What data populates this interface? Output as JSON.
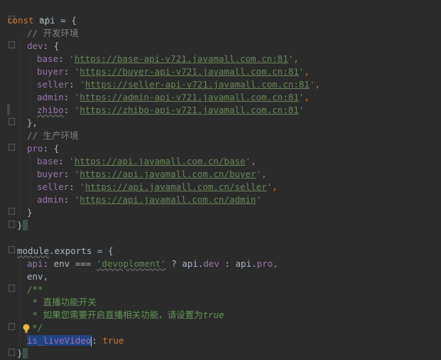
{
  "code": {
    "l0": {
      "comment_close": "*/"
    },
    "l1": {
      "kw": "const",
      "name": " api = {"
    },
    "l2": {
      "comment": "// 开发环境"
    },
    "l3": {
      "key": "dev",
      "rest": ": {"
    },
    "l4": {
      "key": "base",
      "url": "https://base-api-v721.javamall.com.cn:81"
    },
    "l5": {
      "key": "buyer",
      "url": "https://buyer-api-v721.javamall.com.cn:81"
    },
    "l6": {
      "key": "seller",
      "url": "https://seller-api-v721.javamall.com.cn:81"
    },
    "l7": {
      "key": "admin",
      "url": "https://admin-api-v721.javamall.com.cn:81"
    },
    "l8": {
      "key": "zhibo",
      "url": "https://zhibo-api-v721.javamall.com.cn:81"
    },
    "l9": {
      "text": "},"
    },
    "l10": {
      "comment": "// 生产环境"
    },
    "l11": {
      "key": "pro",
      "rest": ": {"
    },
    "l12": {
      "key": "base",
      "url": "https://api.javamall.com.cn/base"
    },
    "l13": {
      "key": "buyer",
      "url": "https://api.javamall.com.cn/buyer"
    },
    "l14": {
      "key": "seller",
      "url": "https://api.javamall.com.cn/seller"
    },
    "l15": {
      "key": "admin",
      "url": "https://api.javamall.com.cn/admin"
    },
    "l16": {
      "text": "}"
    },
    "l17": {
      "text": "}"
    },
    "l19": {
      "a": "module",
      "b": ".exports = {"
    },
    "l20": {
      "key": "api",
      "p1": ": env === ",
      "str": "'devoploment'",
      "p2": " ? api.",
      "dev": "dev",
      "p3": " : api.",
      "pro": "pro",
      "p4": ","
    },
    "l21": {
      "text": "env,"
    },
    "l22": {
      "doc": "/**"
    },
    "l23": {
      "doc": " * 直播功能开关"
    },
    "l24": {
      "doc": " * 如果您需要开启直播相关功能，请设置为",
      "italic": "true"
    },
    "l25": {
      "doc": "*/"
    },
    "l26": {
      "key": "is_liveVideo",
      "rest": ": ",
      "val": "true"
    },
    "l27": {
      "text": "}"
    }
  },
  "colors": {
    "background": "#2b2b2b",
    "keyword": "#cc7832",
    "string": "#6a8759",
    "property": "#9876aa",
    "comment": "#808080",
    "doc": "#629755",
    "selection": "#214283"
  }
}
